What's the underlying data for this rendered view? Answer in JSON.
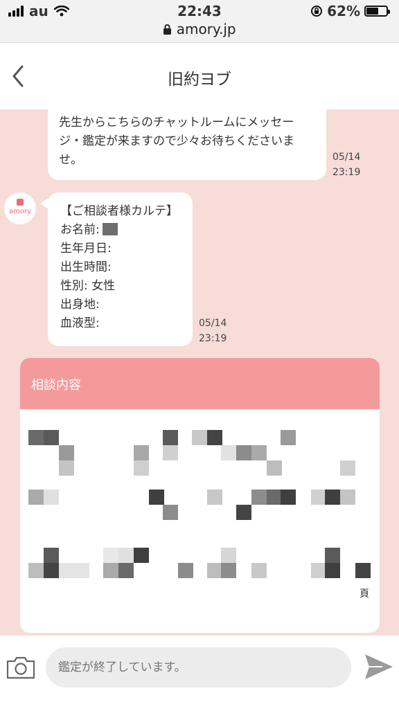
{
  "status_bar": {
    "carrier": "au",
    "time": "22:43",
    "url": "amory.jp",
    "battery_label": "62%",
    "battery_level": 0.62
  },
  "header": {
    "title": "旧約ヨブ",
    "back_icon": "chevron-left-icon"
  },
  "messages": [
    {
      "text": "先生からこちらのチャットルームにメッセージ・鑑定が来ますので少々お待ちくださいませ。",
      "date": "05/14",
      "time": "23:19"
    },
    {
      "avatar_label": "amory",
      "heading": "【ご相談者様カルテ】",
      "fields": [
        "お名前:",
        "生年月日:",
        "出生時間:",
        "性別: 女性",
        "出身地:",
        "血液型:"
      ],
      "date": "05/14",
      "time": "23:19"
    }
  ],
  "consultation_card": {
    "title": "相談内容",
    "header_color": "#f59a9b",
    "trailing_char": "頁"
  },
  "composer": {
    "placeholder": "鑑定が終了しています。",
    "camera_icon": "camera-icon",
    "send_icon": "send-icon"
  },
  "colors": {
    "background": "#f7dcd8",
    "accent": "#ef6b76"
  }
}
